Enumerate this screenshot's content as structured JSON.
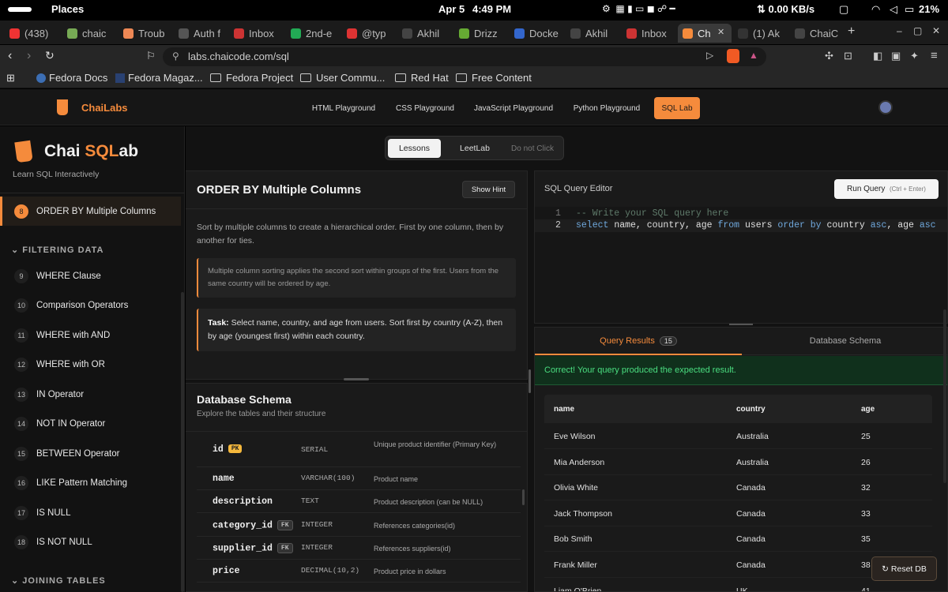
{
  "status_bar": {
    "app": "Places",
    "date": "Apr 5",
    "time": "4:49 PM",
    "net": "0.00 KB/s",
    "battery": "21%"
  },
  "tabs": [
    {
      "label": "(438)",
      "color": "#e33"
    },
    {
      "label": "chaic",
      "color": "#7a5"
    },
    {
      "label": "Troub",
      "color": "#e85"
    },
    {
      "label": "Auth f",
      "color": "#555"
    },
    {
      "label": "Inbox",
      "color": "#c33"
    },
    {
      "label": "2nd-e",
      "color": "#2a5"
    },
    {
      "label": "@typ",
      "color": "#d33"
    },
    {
      "label": "Akhil",
      "color": "#444"
    },
    {
      "label": "Drizz",
      "color": "#6a3"
    },
    {
      "label": "Docke",
      "color": "#36c"
    },
    {
      "label": "Akhil",
      "color": "#444"
    },
    {
      "label": "Inbox",
      "color": "#c33"
    },
    {
      "label": "Ch",
      "color": "#f58b3c"
    },
    {
      "label": "(1) Ak",
      "color": "#333"
    },
    {
      "label": "ChaiC",
      "color": "#444"
    }
  ],
  "url": "labs.chaicode.com/sql",
  "bookmarks": [
    "Fedora Docs",
    "Fedora Magaz...",
    "Fedora Project",
    "User Commu...",
    "Red Hat",
    "Free Content"
  ],
  "header": {
    "brand": "ChaiLabs",
    "nav": [
      "HTML Playground",
      "CSS Playground",
      "JavaScript Playground",
      "Python Playground",
      "SQL Lab"
    ]
  },
  "sidebar": {
    "title_a": "Chai ",
    "title_b": "SQL",
    "title_c": "ab",
    "subtitle": "Learn SQL Interactively",
    "active": {
      "num": "8",
      "label": "ORDER BY Multiple Columns"
    },
    "section1": "FILTERING DATA",
    "lessons": [
      {
        "num": "9",
        "label": "WHERE Clause"
      },
      {
        "num": "10",
        "label": "Comparison Operators"
      },
      {
        "num": "11",
        "label": "WHERE with AND"
      },
      {
        "num": "12",
        "label": "WHERE with OR"
      },
      {
        "num": "13",
        "label": "IN Operator"
      },
      {
        "num": "14",
        "label": "NOT IN Operator"
      },
      {
        "num": "15",
        "label": "BETWEEN Operator"
      },
      {
        "num": "16",
        "label": "LIKE Pattern Matching"
      },
      {
        "num": "17",
        "label": "IS NULL"
      },
      {
        "num": "18",
        "label": "IS NOT NULL"
      }
    ],
    "section2": "JOINING TABLES"
  },
  "mode_tabs": [
    "Lessons",
    "LeetLab",
    "Do not Click"
  ],
  "lesson": {
    "title": "ORDER BY Multiple Columns",
    "hint": "Show Hint",
    "description": "Sort by multiple columns to create a hierarchical order. First by one column, then by another for ties.",
    "note": "Multiple column sorting applies the second sort within groups of the first. Users from the same country will be ordered by age.",
    "task_label": "Task:",
    "task": "Select name, country, and age from users. Sort first by country (A-Z), then by age (youngest first) within each country."
  },
  "schema": {
    "title": "Database Schema",
    "subtitle": "Explore the tables and their structure",
    "rows": [
      {
        "col": "id",
        "tag": "PK",
        "type": "SERIAL",
        "desc": "Unique product identifier (Primary Key)"
      },
      {
        "col": "name",
        "tag": "",
        "type": "VARCHAR(100)",
        "desc": "Product name"
      },
      {
        "col": "description",
        "tag": "",
        "type": "TEXT",
        "desc": "Product description (can be NULL)"
      },
      {
        "col": "category_id",
        "tag": "FK",
        "type": "INTEGER",
        "desc": "References categories(id)"
      },
      {
        "col": "supplier_id",
        "tag": "FK",
        "type": "INTEGER",
        "desc": "References suppliers(id)"
      },
      {
        "col": "price",
        "tag": "",
        "type": "DECIMAL(10,2)",
        "desc": "Product price in dollars"
      }
    ]
  },
  "editor": {
    "title": "SQL Query Editor",
    "run": "Run Query",
    "shortcut": "(Ctrl + Enter)",
    "line1_no": "1",
    "line2_no": "2",
    "line1": "-- Write your SQL query here",
    "line2": [
      {
        "t": "select",
        "c": "kw"
      },
      {
        "t": " name, country, age ",
        "c": "tx"
      },
      {
        "t": "from",
        "c": "kw"
      },
      {
        "t": " users ",
        "c": "tx"
      },
      {
        "t": "order by",
        "c": "kw"
      },
      {
        "t": " country ",
        "c": "tx"
      },
      {
        "t": "asc",
        "c": "kw"
      },
      {
        "t": ", age ",
        "c": "tx"
      },
      {
        "t": "asc",
        "c": "kw"
      }
    ]
  },
  "results": {
    "tab1": "Query Results",
    "count": "15",
    "tab2": "Database Schema",
    "message": "Correct! Your query produced the expected result.",
    "columns": [
      "name",
      "country",
      "age"
    ],
    "rows": [
      [
        "Eve Wilson",
        "Australia",
        "25"
      ],
      [
        "Mia Anderson",
        "Australia",
        "26"
      ],
      [
        "Olivia White",
        "Canada",
        "32"
      ],
      [
        "Jack Thompson",
        "Canada",
        "33"
      ],
      [
        "Bob Smith",
        "Canada",
        "35"
      ],
      [
        "Frank Miller",
        "Canada",
        "38"
      ],
      [
        "Liam O'Brien",
        "UK",
        "41"
      ]
    ],
    "reset": "Reset DB"
  },
  "colors": {
    "accent": "#f58b3c",
    "success_bg": "#10301c",
    "success_text": "#4ade80"
  }
}
